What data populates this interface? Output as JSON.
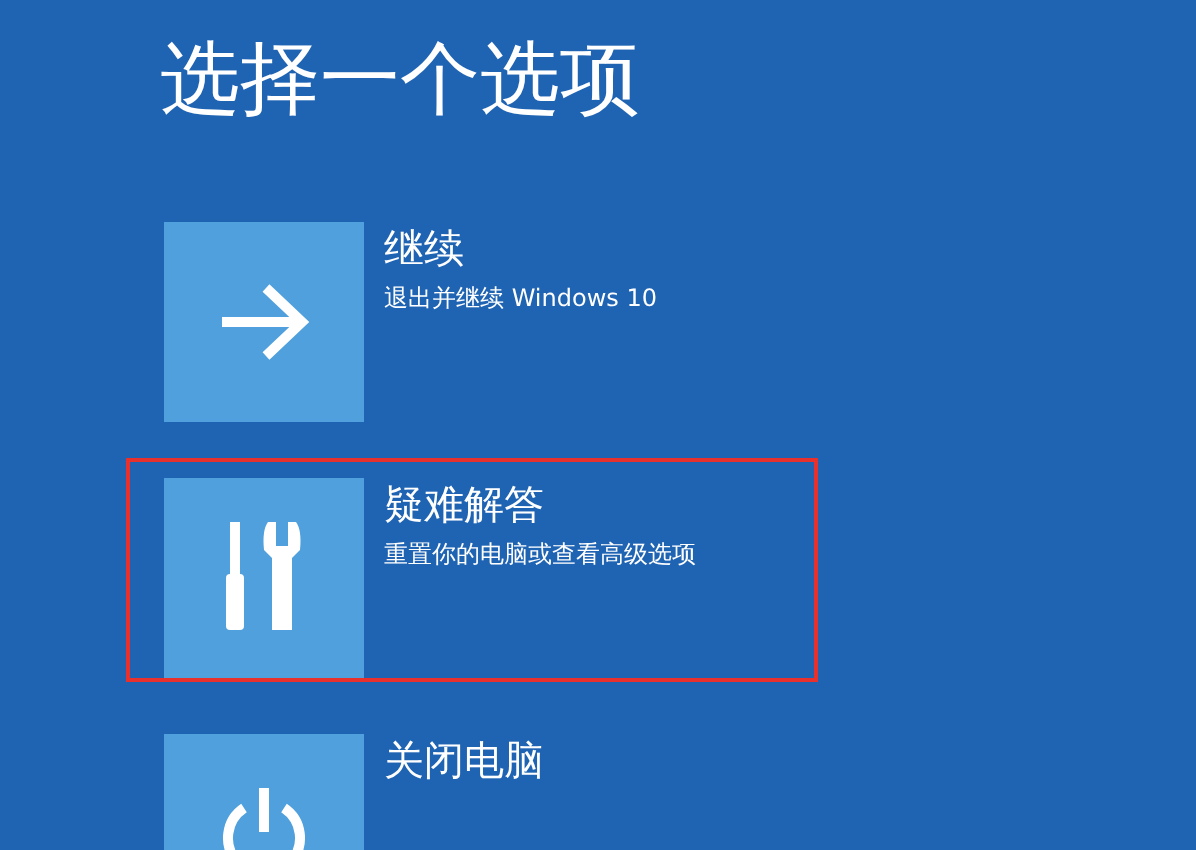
{
  "title": "选择一个选项",
  "options": [
    {
      "kind": "arrow",
      "title": "继续",
      "subtitle": "退出并继续 Windows 10",
      "highlighted": false
    },
    {
      "kind": "tools",
      "title": "疑难解答",
      "subtitle": "重置你的电脑或查看高级选项",
      "highlighted": true
    },
    {
      "kind": "power",
      "title": "关闭电脑",
      "highlighted": false
    }
  ]
}
